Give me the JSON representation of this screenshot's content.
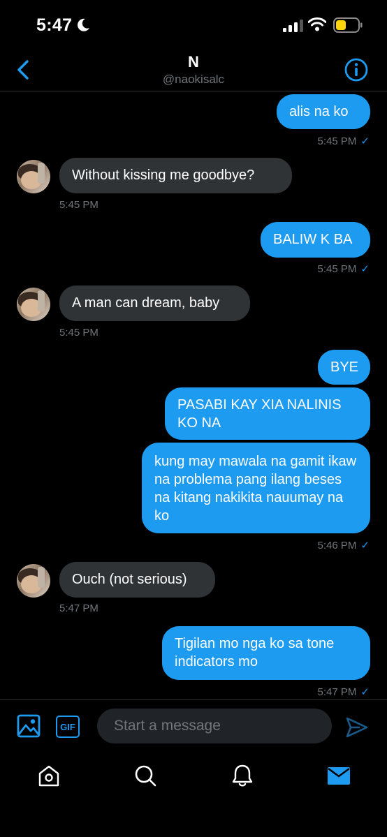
{
  "status_bar": {
    "time": "5:47"
  },
  "header": {
    "name": "N",
    "handle": "@naokisalc"
  },
  "messages": [
    {
      "dir": "sent",
      "text": "alis na ko",
      "time": "5:45 PM",
      "read": true
    },
    {
      "dir": "recv",
      "text": "Without kissing me goodbye?",
      "time": "5:45 PM"
    },
    {
      "dir": "sent",
      "text": "BALIW K BA",
      "time": "5:45 PM",
      "read": true
    },
    {
      "dir": "recv",
      "text": "A man can dream, baby",
      "time": "5:45 PM"
    },
    {
      "dir": "sent",
      "text": "BYE"
    },
    {
      "dir": "sent",
      "text": "PASABI KAY XIA NALINIS KO NA"
    },
    {
      "dir": "sent",
      "text": "kung may mawala na gamit ikaw na problema pang ilang beses na kitang nakikita nauumay na ko",
      "time": "5:46 PM",
      "read": true
    },
    {
      "dir": "recv",
      "text": "Ouch (not serious)",
      "time": "5:47 PM"
    },
    {
      "dir": "sent",
      "text": "Tigilan mo nga ko sa tone indicators mo",
      "time": "5:47 PM",
      "read": true
    }
  ],
  "composer": {
    "placeholder": "Start a message",
    "gif_label": "GIF"
  },
  "icons": {
    "back": "chevron-left-icon",
    "info": "info-icon",
    "image": "image-icon",
    "send": "send-icon",
    "tabs": [
      "home-icon",
      "search-icon",
      "bell-icon",
      "mail-icon"
    ]
  },
  "colors": {
    "accent": "#1d9bf0",
    "background": "#000000",
    "received_bubble": "#2f3336",
    "muted_text": "#71767b"
  }
}
